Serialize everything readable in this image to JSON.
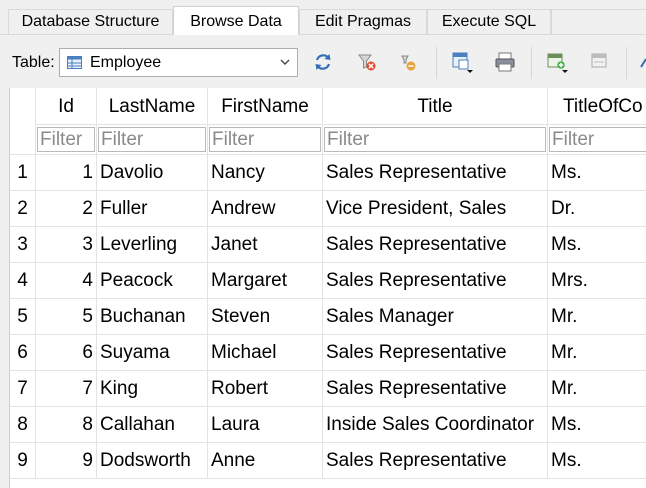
{
  "tabs": [
    {
      "label": "Database Structure"
    },
    {
      "label": "Browse Data"
    },
    {
      "label": "Edit Pragmas"
    },
    {
      "label": "Execute SQL"
    }
  ],
  "toolbar": {
    "table_label": "Table:",
    "table_value": "Employee",
    "icons": [
      "refresh-icon",
      "clear-filters-icon",
      "delete-filter-icon",
      "save-table-icon",
      "print-icon",
      "insert-record-icon",
      "delete-record-icon"
    ]
  },
  "grid": {
    "columns": [
      "Id",
      "LastName",
      "FirstName",
      "Title",
      "TitleOfCo"
    ],
    "filter_placeholder": "Filter",
    "row_numbers": [
      "1",
      "2",
      "3",
      "4",
      "5",
      "6",
      "7",
      "8",
      "9"
    ],
    "rows": [
      [
        "1",
        "Davolio",
        "Nancy",
        "Sales Representative",
        "Ms."
      ],
      [
        "2",
        "Fuller",
        "Andrew",
        "Vice President, Sales",
        "Dr."
      ],
      [
        "3",
        "Leverling",
        "Janet",
        "Sales Representative",
        "Ms."
      ],
      [
        "4",
        "Peacock",
        "Margaret",
        "Sales Representative",
        "Mrs."
      ],
      [
        "5",
        "Buchanan",
        "Steven",
        "Sales Manager",
        "Mr."
      ],
      [
        "6",
        "Suyama",
        "Michael",
        "Sales Representative",
        "Mr."
      ],
      [
        "7",
        "King",
        "Robert",
        "Sales Representative",
        "Mr."
      ],
      [
        "8",
        "Callahan",
        "Laura",
        "Inside Sales Coordinator",
        "Ms."
      ],
      [
        "9",
        "Dodsworth",
        "Anne",
        "Sales Representative",
        "Ms."
      ]
    ]
  },
  "colors": {
    "accent_blue": "#2f6fb5",
    "grid_line": "#e3e3e3",
    "filter_text": "#8a8a8a"
  }
}
